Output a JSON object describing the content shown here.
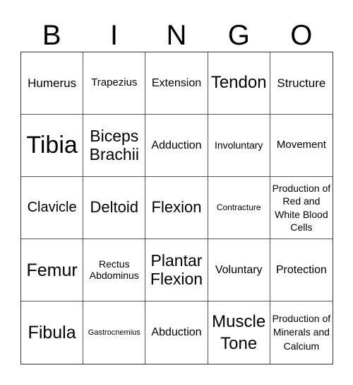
{
  "header": {
    "letters": [
      "B",
      "I",
      "N",
      "G",
      "O"
    ]
  },
  "grid": {
    "cells": [
      "Humerus",
      "Trapezius",
      "Extension",
      "Tendon",
      "Structure",
      "Tibia",
      "Biceps Brachii",
      "Adduction",
      "Involuntary",
      "Movement",
      "Clavicle",
      "Deltoid",
      "Flexion",
      "Contracture",
      "Production of Red and White Blood Cells",
      "Femur",
      "Rectus Abdominus",
      "Plantar Flexion",
      "Voluntary",
      "Protection",
      "Fibula",
      "Gastrocnemius",
      "Abduction",
      "Muscle Tone",
      "Production of Minerals and Calcium"
    ]
  },
  "colors": {
    "background": "#ffffff",
    "text": "#000000",
    "grid_line": "#555555"
  }
}
